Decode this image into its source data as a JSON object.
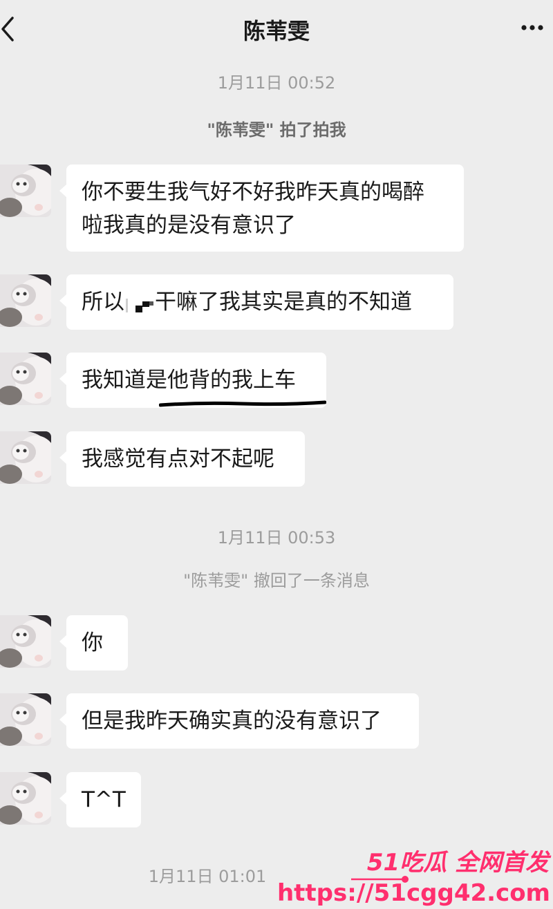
{
  "header": {
    "title": "陈苇雯"
  },
  "timestamps": [
    "1月11日 00:52",
    "1月11日 00:53",
    "1月11日 01:01"
  ],
  "system_messages": {
    "pat": "\"陈苇雯\" 拍了拍我",
    "recall": "\"陈苇雯\" 撤回了一条消息"
  },
  "messages": [
    {
      "line1": "你不要生我气好不好我昨天真的喝醉",
      "line2": "啦我真的是没有意识了"
    },
    {
      "before": "所以",
      "after": "干嘛了我其实是真的不知道"
    },
    {
      "text": "我知道是他背的我上车"
    },
    {
      "text": "我感觉有点对不起呢"
    },
    {
      "text": "你"
    },
    {
      "text": "但是我昨天确实真的没有意识了"
    },
    {
      "text": "T^T"
    }
  ],
  "watermark": {
    "brand": "51吃瓜 全网首发",
    "url": "https://51cgg42.com"
  },
  "icons": {
    "back": "chevron-left-icon",
    "more": "ellipsis-icon",
    "avatar": "cat-avatar"
  },
  "colors": {
    "background": "#ededed",
    "bubble": "#ffffff",
    "watermark": "#ff2f6e"
  }
}
